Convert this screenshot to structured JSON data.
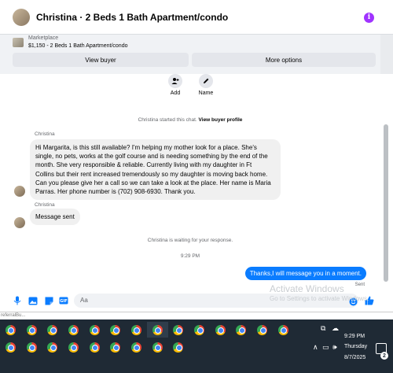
{
  "header": {
    "title": "Christina · 2 Beds 1 Bath Apartment/condo",
    "info_icon": "i"
  },
  "listing": {
    "label": "Marketplace",
    "description": "$1,150 - 2 Beds 1 Bath Apartment/condo",
    "view_buyer": "View buyer",
    "more_options": "More options"
  },
  "actions": {
    "add": "Add",
    "name": "Name"
  },
  "chat": {
    "started": "Christina started this chat.",
    "view_profile": "View buyer profile",
    "sender": "Christina",
    "message1_lines": [
      "Hi Margarita, is this still available? I'm helping my mother look for a place. She's",
      "single, no pets, works at the golf course and is needing something by the end of the",
      "month. She very responsible & reliable. Currently living with my daughter in Ft",
      "Collins but their rent increased tremendously so my daughter is moving back home.",
      "Can you please give her a call so we can take a look at the place. Her name is Maria",
      "Parras. Her phone number is (702) 908-6930. Thank you."
    ],
    "sender2": "Christina",
    "message2": "Message sent",
    "waiting": "Christina is waiting for your response.",
    "time": "9:29 PM",
    "reply": "Thanks,I will message you in a moment.",
    "sent": "Sent"
  },
  "composer": {
    "placeholder": "Aa"
  },
  "watermark": {
    "line1": "Activate Windows",
    "line2": "Go to Settings to activate Windows."
  },
  "referral": "referralBu...",
  "taskbar": {
    "time": "9:29 PM",
    "day": "Thursday",
    "date": "8/7/2025",
    "badge": "2"
  },
  "colors": {
    "accent": "#0a7cff",
    "info": "#a033ff",
    "taskbar": "#1f2a35"
  }
}
